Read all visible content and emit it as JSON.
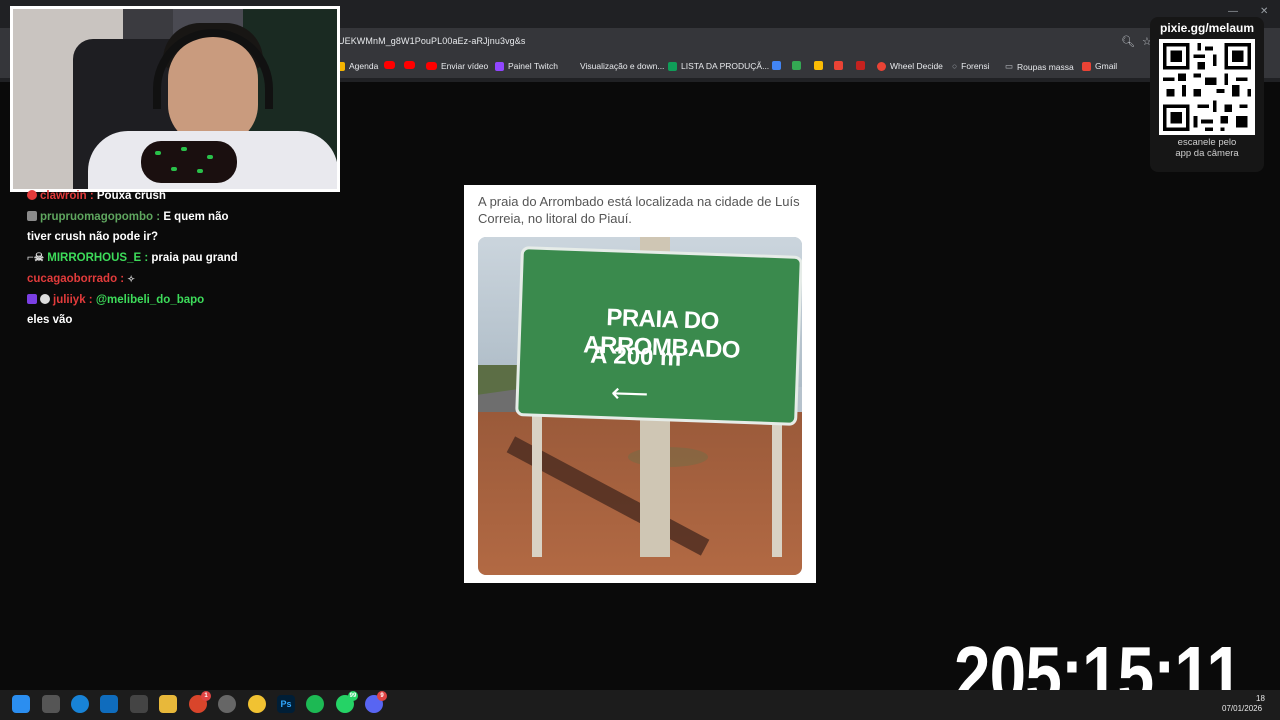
{
  "browser": {
    "url": "UEKWMnM_g8W1PouPL00aEz-aRJjnu3vg&s",
    "bookmarks": [
      {
        "label": "Agenda",
        "icon": "bookmark-folder-icon"
      },
      {
        "label": "",
        "icon": "youtube-icon"
      },
      {
        "label": "",
        "icon": "youtube-icon"
      },
      {
        "label": "Enviar vídeo",
        "icon": "youtube-icon"
      },
      {
        "label": "Painel Twitch",
        "icon": "twitch-icon"
      },
      {
        "label": "Visualização e down...",
        "icon": "page-icon"
      },
      {
        "label": "LISTA DA PRODUÇÃ...",
        "icon": "sheets-icon"
      },
      {
        "label": "Wheel Decide",
        "icon": "wheel-icon"
      },
      {
        "label": "Forensi",
        "icon": "page-icon"
      },
      {
        "label": "Roupas massa",
        "icon": "folder-icon"
      },
      {
        "label": "Gmail",
        "icon": "gmail-icon"
      }
    ]
  },
  "chat": [
    {
      "user": "clawroin",
      "user_color": "#e23b3b",
      "message": "Pouxa crush"
    },
    {
      "user": "prupruomagopombo",
      "user_color": "#5fa65f",
      "message": "E quem não tiver crush não pode ir?"
    },
    {
      "user": "MIRRORHOUS_E",
      "user_color": "#3ddc5a",
      "message": "praia pau grand"
    },
    {
      "user": "cucagaoborrado",
      "user_color": "#e23b3b",
      "message": ""
    },
    {
      "user": "juliiyk",
      "user_color": "#e23b3b",
      "message": "@melibeli_do_bapo",
      "message_color": "#3ddc5a",
      "continuation": "eles vão"
    }
  ],
  "post": {
    "caption": "A praia do Arrombado está localizada na cidade de Luís Correia, no litoral do Piauí.",
    "sign_line1": "PRAIA DO ARROMBADO",
    "sign_line2": "A 200 m",
    "sign_arrow": "⟵"
  },
  "qr": {
    "url": "pixie.gg/melaum",
    "caption_line1": "escanele pelo",
    "caption_line2": "app da câmera"
  },
  "timer": "205:15:11",
  "taskbar": {
    "date": "07/01/2026",
    "time": "18"
  },
  "colors": {
    "accent_green": "#3ddc5a",
    "accent_red": "#e23b3b",
    "sign_green": "#3a8a4d"
  }
}
